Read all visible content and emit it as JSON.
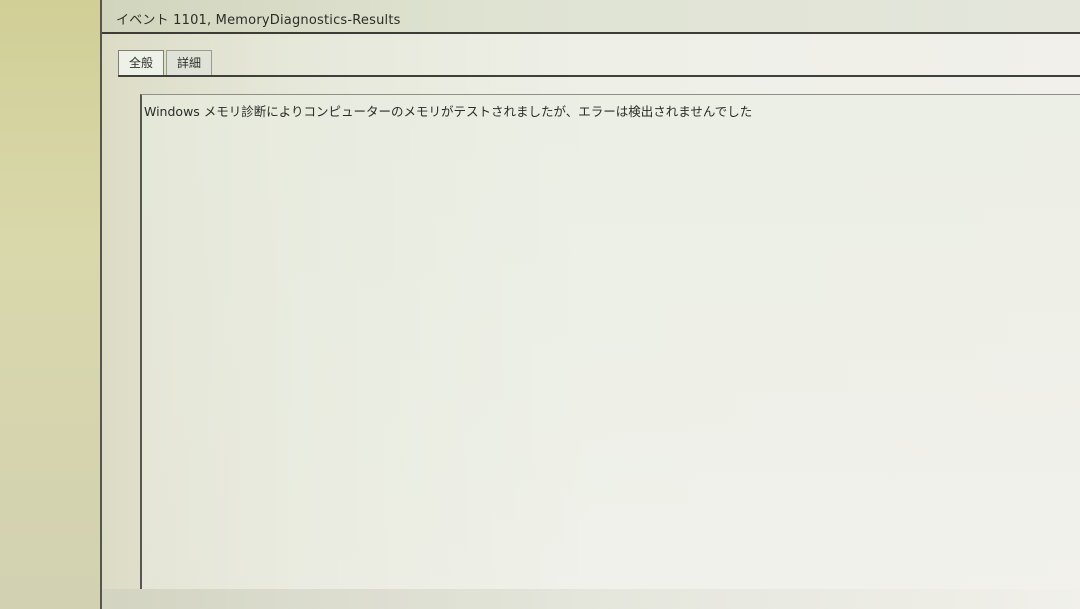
{
  "window": {
    "title": "イベント 1101, MemoryDiagnostics-Results"
  },
  "tabs": [
    {
      "label": "全般",
      "active": true
    },
    {
      "label": "詳細",
      "active": false
    }
  ],
  "general": {
    "message": "Windows メモリ診断によりコンピューターのメモリがテストされましたが、エラーは検出されませんでした"
  }
}
